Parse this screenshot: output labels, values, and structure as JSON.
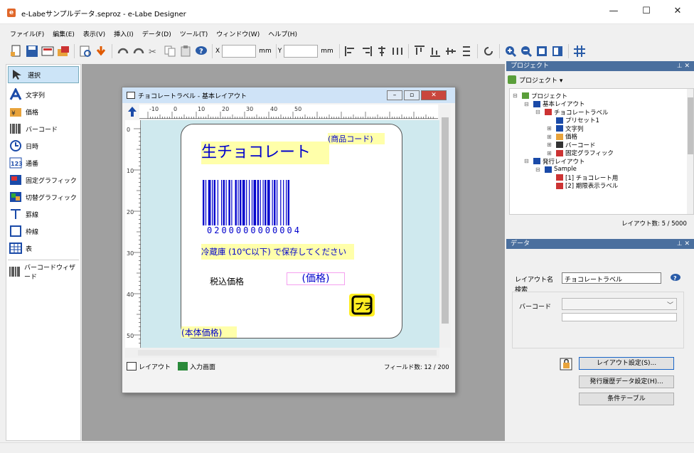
{
  "window": {
    "title": "e-Labeサンプルデータ.seproz - e-Labe Designer",
    "min": "—",
    "max": "☐",
    "close": "✕"
  },
  "menu": [
    "ファイル(F)",
    "編集(E)",
    "表示(V)",
    "挿入(I)",
    "データ(D)",
    "ツール(T)",
    "ウィンドウ(W)",
    "ヘルプ(H)"
  ],
  "toolbar": {
    "x_label": "X",
    "x_unit": "mm",
    "y_label": "Y",
    "y_unit": "mm"
  },
  "palette": [
    {
      "label": "選択",
      "icon": "select-arrow-icon"
    },
    {
      "label": "文字列",
      "icon": "text-icon"
    },
    {
      "label": "価格",
      "icon": "price-icon"
    },
    {
      "label": "バーコード",
      "icon": "barcode-icon"
    },
    {
      "label": "日時",
      "icon": "clock-icon"
    },
    {
      "label": "通番",
      "icon": "serial-number-icon"
    },
    {
      "label": "固定グラフィック",
      "icon": "fixed-graphic-icon"
    },
    {
      "label": "切替グラフィック",
      "icon": "switch-graphic-icon"
    },
    {
      "label": "罫線",
      "icon": "line-icon"
    },
    {
      "label": "枠線",
      "icon": "frame-icon"
    },
    {
      "label": "表",
      "icon": "table-icon"
    },
    {
      "label": "バーコードウィザード",
      "icon": "barcode-wizard-icon"
    }
  ],
  "inner_window": {
    "title": "チョコレートラベル - 基本レイアウト",
    "ruler_top": [
      "-10",
      "0",
      "10",
      "20",
      "30",
      "40",
      "50"
    ],
    "ruler_left": [
      "0",
      "10",
      "20",
      "30",
      "40",
      "50"
    ],
    "tabs": [
      "レイアウト",
      "入力画面"
    ],
    "field_count": "フィールド数: 12 / 200"
  },
  "label": {
    "product_code": "(商品コード)",
    "product_name": "生チョコレート",
    "barcode_digits": "0200000000004",
    "storage_note": "冷蔵庫 (10℃以下) で保存してください",
    "tax_price_label": "税込価格",
    "price_field": "(価格)",
    "base_price": "(本体価格)",
    "recycle_mark": "プラ"
  },
  "project_panel": {
    "header": "プロジェクト",
    "dropdown": "プロジェクト ▾",
    "tree": [
      {
        "text": "プロジェクト",
        "indent": 0,
        "sign": "⊟"
      },
      {
        "text": "基本レイアウト",
        "indent": 1,
        "sign": "⊟"
      },
      {
        "text": "チョコレートラベル",
        "indent": 2,
        "sign": "⊟"
      },
      {
        "text": "プリセット1",
        "indent": 3,
        "sign": ""
      },
      {
        "text": "文字列",
        "indent": 3,
        "sign": "⊞"
      },
      {
        "text": "価格",
        "indent": 3,
        "sign": "⊞"
      },
      {
        "text": "バーコード",
        "indent": 3,
        "sign": "⊞"
      },
      {
        "text": "固定グラフィック",
        "indent": 3,
        "sign": "⊞"
      },
      {
        "text": "発行レイアウト",
        "indent": 1,
        "sign": "⊟"
      },
      {
        "text": "Sample",
        "indent": 2,
        "sign": "⊟"
      },
      {
        "text": "[1] チョコレート用",
        "indent": 3,
        "sign": ""
      },
      {
        "text": "[2] 期限表示ラベル",
        "indent": 3,
        "sign": ""
      }
    ],
    "layout_count": "レイアウト数: 5 / 5000"
  },
  "data_panel": {
    "header": "データ",
    "layout_name_label": "レイアウト名",
    "layout_name_value": "チョコレートラベル",
    "search_label": "検索",
    "barcode_label": "バーコード",
    "layout_settings_btn": "レイアウト設定(S)...",
    "history_settings_btn": "発行履歴データ設定(H)...",
    "condition_table_btn": "条件テーブル"
  },
  "colors": {
    "accent": "#4a6f9e",
    "field_yellow": "#ffffaa",
    "label_blue": "#0000cc"
  }
}
